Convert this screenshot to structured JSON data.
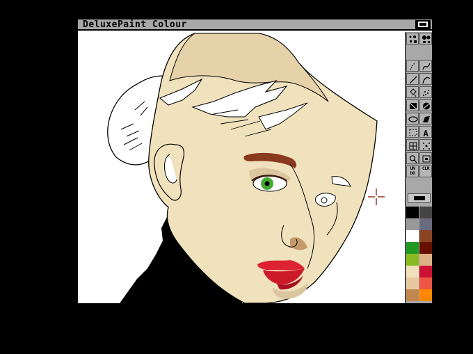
{
  "window": {
    "title": "DeluxePaint Colour"
  },
  "toolbox": {
    "tools": [
      {
        "name": "brush-dots-tool",
        "row": 0,
        "col": 0
      },
      {
        "name": "brush-sizes-tool",
        "row": 0,
        "col": 1
      },
      {
        "name": "dotted-freehand-tool",
        "row": 1,
        "col": 0
      },
      {
        "name": "continuous-freehand-tool",
        "row": 1,
        "col": 1
      },
      {
        "name": "line-tool",
        "row": 2,
        "col": 0
      },
      {
        "name": "curve-tool",
        "row": 2,
        "col": 1
      },
      {
        "name": "fill-tool",
        "row": 3,
        "col": 0
      },
      {
        "name": "airbrush-tool",
        "row": 3,
        "col": 1
      },
      {
        "name": "rectangle-tool",
        "row": 4,
        "col": 0
      },
      {
        "name": "circle-tool",
        "row": 4,
        "col": 1
      },
      {
        "name": "ellipse-tool",
        "row": 5,
        "col": 0
      },
      {
        "name": "polygon-tool",
        "row": 5,
        "col": 1
      },
      {
        "name": "brush-select-tool",
        "row": 6,
        "col": 0
      },
      {
        "name": "text-tool",
        "row": 6,
        "col": 1
      },
      {
        "name": "grid-tool",
        "row": 7,
        "col": 0
      },
      {
        "name": "symmetry-tool",
        "row": 7,
        "col": 1
      },
      {
        "name": "magnify-tool",
        "row": 8,
        "col": 0
      },
      {
        "name": "zoom-tool",
        "row": 8,
        "col": 1
      },
      {
        "name": "undo-button",
        "row": 9,
        "col": 0,
        "label": "UN DO"
      },
      {
        "name": "clear-button",
        "row": 9,
        "col": 1,
        "label": "CLR"
      }
    ],
    "palette": [
      "#000000",
      "#444444",
      "#999999",
      "#6a6a7e",
      "#ffffff",
      "#8a4422",
      "#229922",
      "#661100",
      "#88bb22",
      "#ddb088",
      "#f0e0bb",
      "#cc1133",
      "#e8c8a0",
      "#ee5544",
      "#c08850",
      "#ff8800"
    ]
  },
  "colors": {
    "skin": "#f0e2bc",
    "skin_shadow": "#dcc6a0",
    "hair_shade": "#e6d2a8",
    "brow": "#8a3a1e",
    "iris": "#44aa33",
    "lips": "#dd2233",
    "lips_shadow": "#aa1122",
    "nose_shadow": "#c49a6a",
    "turtleneck": "#000000",
    "crosshair": "#880000"
  }
}
